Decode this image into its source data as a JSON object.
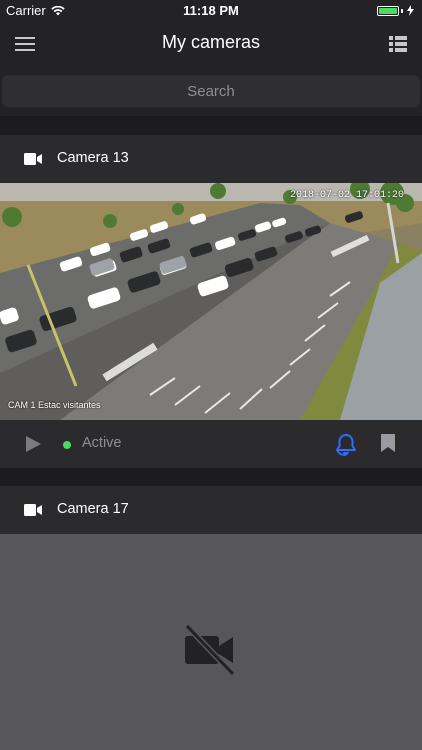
{
  "status_bar": {
    "carrier": "Carrier",
    "time": "11:18 PM",
    "battery_color": "#4cd964"
  },
  "nav": {
    "title": "My cameras",
    "left_icon": "hamburger-menu-icon",
    "right_icon": "list-view-icon"
  },
  "search": {
    "placeholder": "Search",
    "value": ""
  },
  "cameras": [
    {
      "name": "Camera 13",
      "feed_timestamp": "2018-07-02 17:01:20",
      "feed_caption": "CAM 1 Estac visitantes",
      "status": "Active",
      "status_color": "#4cd964",
      "alert_icon_color": "#2f6bff"
    },
    {
      "name": "Camera 17",
      "feed": "no-video-icon"
    }
  ]
}
